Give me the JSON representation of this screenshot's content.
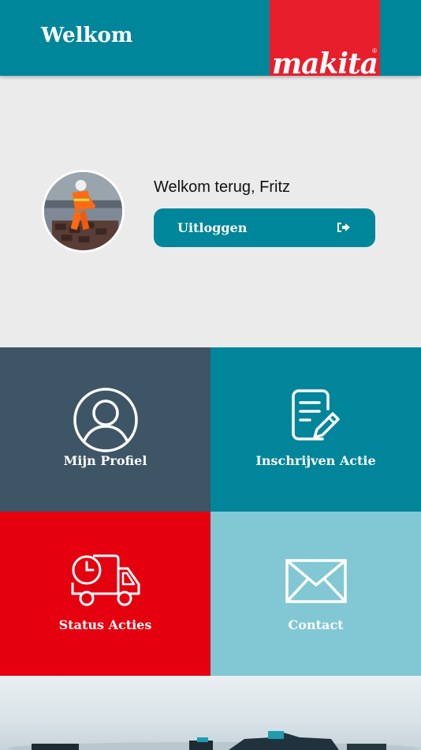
{
  "header": {
    "title": "Welkom",
    "brand_logo_text": "makita",
    "brand_logo_mark": "®",
    "brand_color": "#e81e2b",
    "bar_color": "#00869a"
  },
  "welcome": {
    "greeting": "Welkom terug, Fritz",
    "logout_label": "Uitloggen",
    "logout_icon": "sign-out-icon",
    "avatar_image": "worker-laying-bricks-photo"
  },
  "tiles": [
    {
      "label": "Mijn Profiel",
      "icon": "user-profile-icon",
      "color": "#3e5566"
    },
    {
      "label": "Inschrijven Actie",
      "icon": "document-edit-icon",
      "color": "#00859a"
    },
    {
      "label": "Status Acties",
      "icon": "delivery-truck-clock-icon",
      "color": "#e4000f"
    },
    {
      "label": "Contact",
      "icon": "envelope-icon",
      "color": "#82c7d4"
    }
  ],
  "banner": {
    "image": "power-tools-product-photo"
  }
}
